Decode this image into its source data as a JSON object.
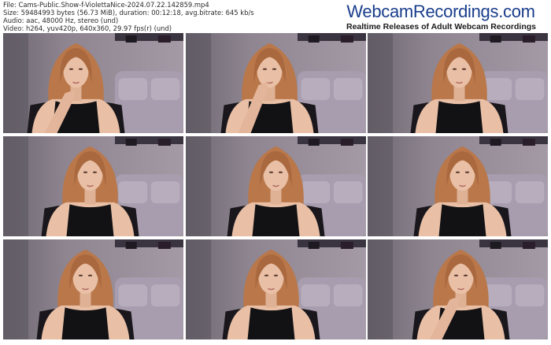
{
  "header": {
    "file_line": "File: Cams-Public.Show-f-ViolettaNice-2024.07.22.142859.mp4",
    "size_line": "Size: 59484993 bytes (56.73 MiB), duration: 00:12:18, avg.bitrate: 645 kb/s",
    "audio_line": "Audio: aac, 48000 Hz, stereo (und)",
    "video_line": "Video: h264, yuv420p, 640x360, 29.97 fps(r) (und)"
  },
  "brand": {
    "name": "WebcamRecordings.com",
    "tagline": "Realtime Releases of Adult Webcam Recordings"
  },
  "thumbnails": [
    {
      "pose": "closeup-hand-chin"
    },
    {
      "pose": "hand-mouth"
    },
    {
      "pose": "center"
    },
    {
      "pose": "center"
    },
    {
      "pose": "center"
    },
    {
      "pose": "center"
    },
    {
      "pose": "center"
    },
    {
      "pose": "center"
    },
    {
      "pose": "hand-chin"
    }
  ],
  "colors": {
    "brand_blue": "#1a3e8c",
    "wall": "#8e8590",
    "hair": "#b9774a",
    "skin": "#e9c0a6",
    "top": "#121114"
  }
}
